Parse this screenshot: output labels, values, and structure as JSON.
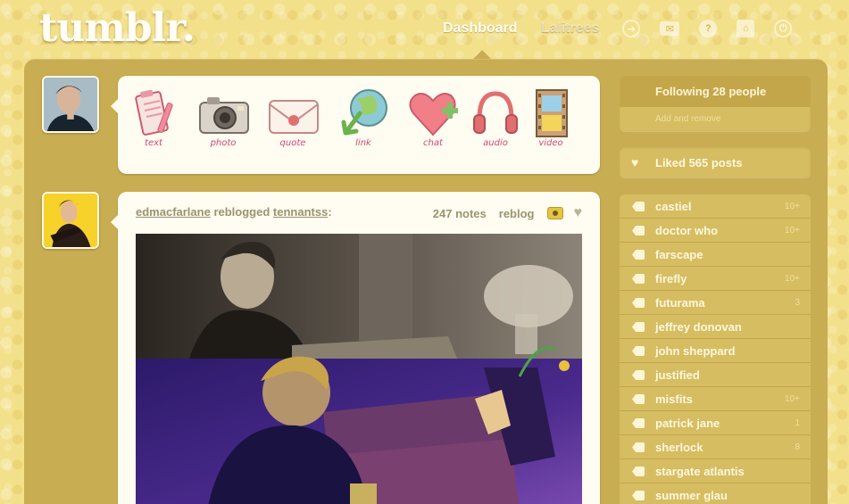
{
  "header": {
    "logo": "tumblr.",
    "nav": [
      {
        "label": "Dashboard",
        "active": true
      },
      {
        "label": "Lalitrees",
        "active": false
      }
    ],
    "icons": [
      "explore-icon",
      "inbox-icon",
      "help-icon",
      "home-icon",
      "logout-icon"
    ]
  },
  "post_types": [
    {
      "label": "text",
      "icon": "notepad-icon"
    },
    {
      "label": "photo",
      "icon": "camera-icon"
    },
    {
      "label": "quote",
      "icon": "envelope-icon"
    },
    {
      "label": "link",
      "icon": "globe-arrow-icon"
    },
    {
      "label": "chat",
      "icon": "heart-plus-icon"
    },
    {
      "label": "audio",
      "icon": "headphones-icon"
    },
    {
      "label": "video",
      "icon": "film-icon"
    }
  ],
  "post": {
    "author": "edmacfarlane",
    "action": "reblogged",
    "source": "tennantss",
    "notes": "247 notes",
    "reblog": "reblog"
  },
  "sidebar": {
    "following": "Following 28 people",
    "add_remove": "Add and remove",
    "liked": "Liked 565 posts",
    "tags": [
      {
        "name": "castiel",
        "count": "10+"
      },
      {
        "name": "doctor who",
        "count": "10+"
      },
      {
        "name": "farscape",
        "count": ""
      },
      {
        "name": "firefly",
        "count": "10+"
      },
      {
        "name": "futurama",
        "count": "3"
      },
      {
        "name": "jeffrey donovan",
        "count": ""
      },
      {
        "name": "john sheppard",
        "count": ""
      },
      {
        "name": "justified",
        "count": ""
      },
      {
        "name": "misfits",
        "count": "10+"
      },
      {
        "name": "patrick jane",
        "count": "1"
      },
      {
        "name": "sherlock",
        "count": "8"
      },
      {
        "name": "stargate atlantis",
        "count": ""
      },
      {
        "name": "summer glau",
        "count": ""
      }
    ]
  },
  "colors": {
    "background": "#f3e08a",
    "container": "#c9ad52",
    "card": "#fffcf1",
    "post_type_label": "#d2467a"
  }
}
